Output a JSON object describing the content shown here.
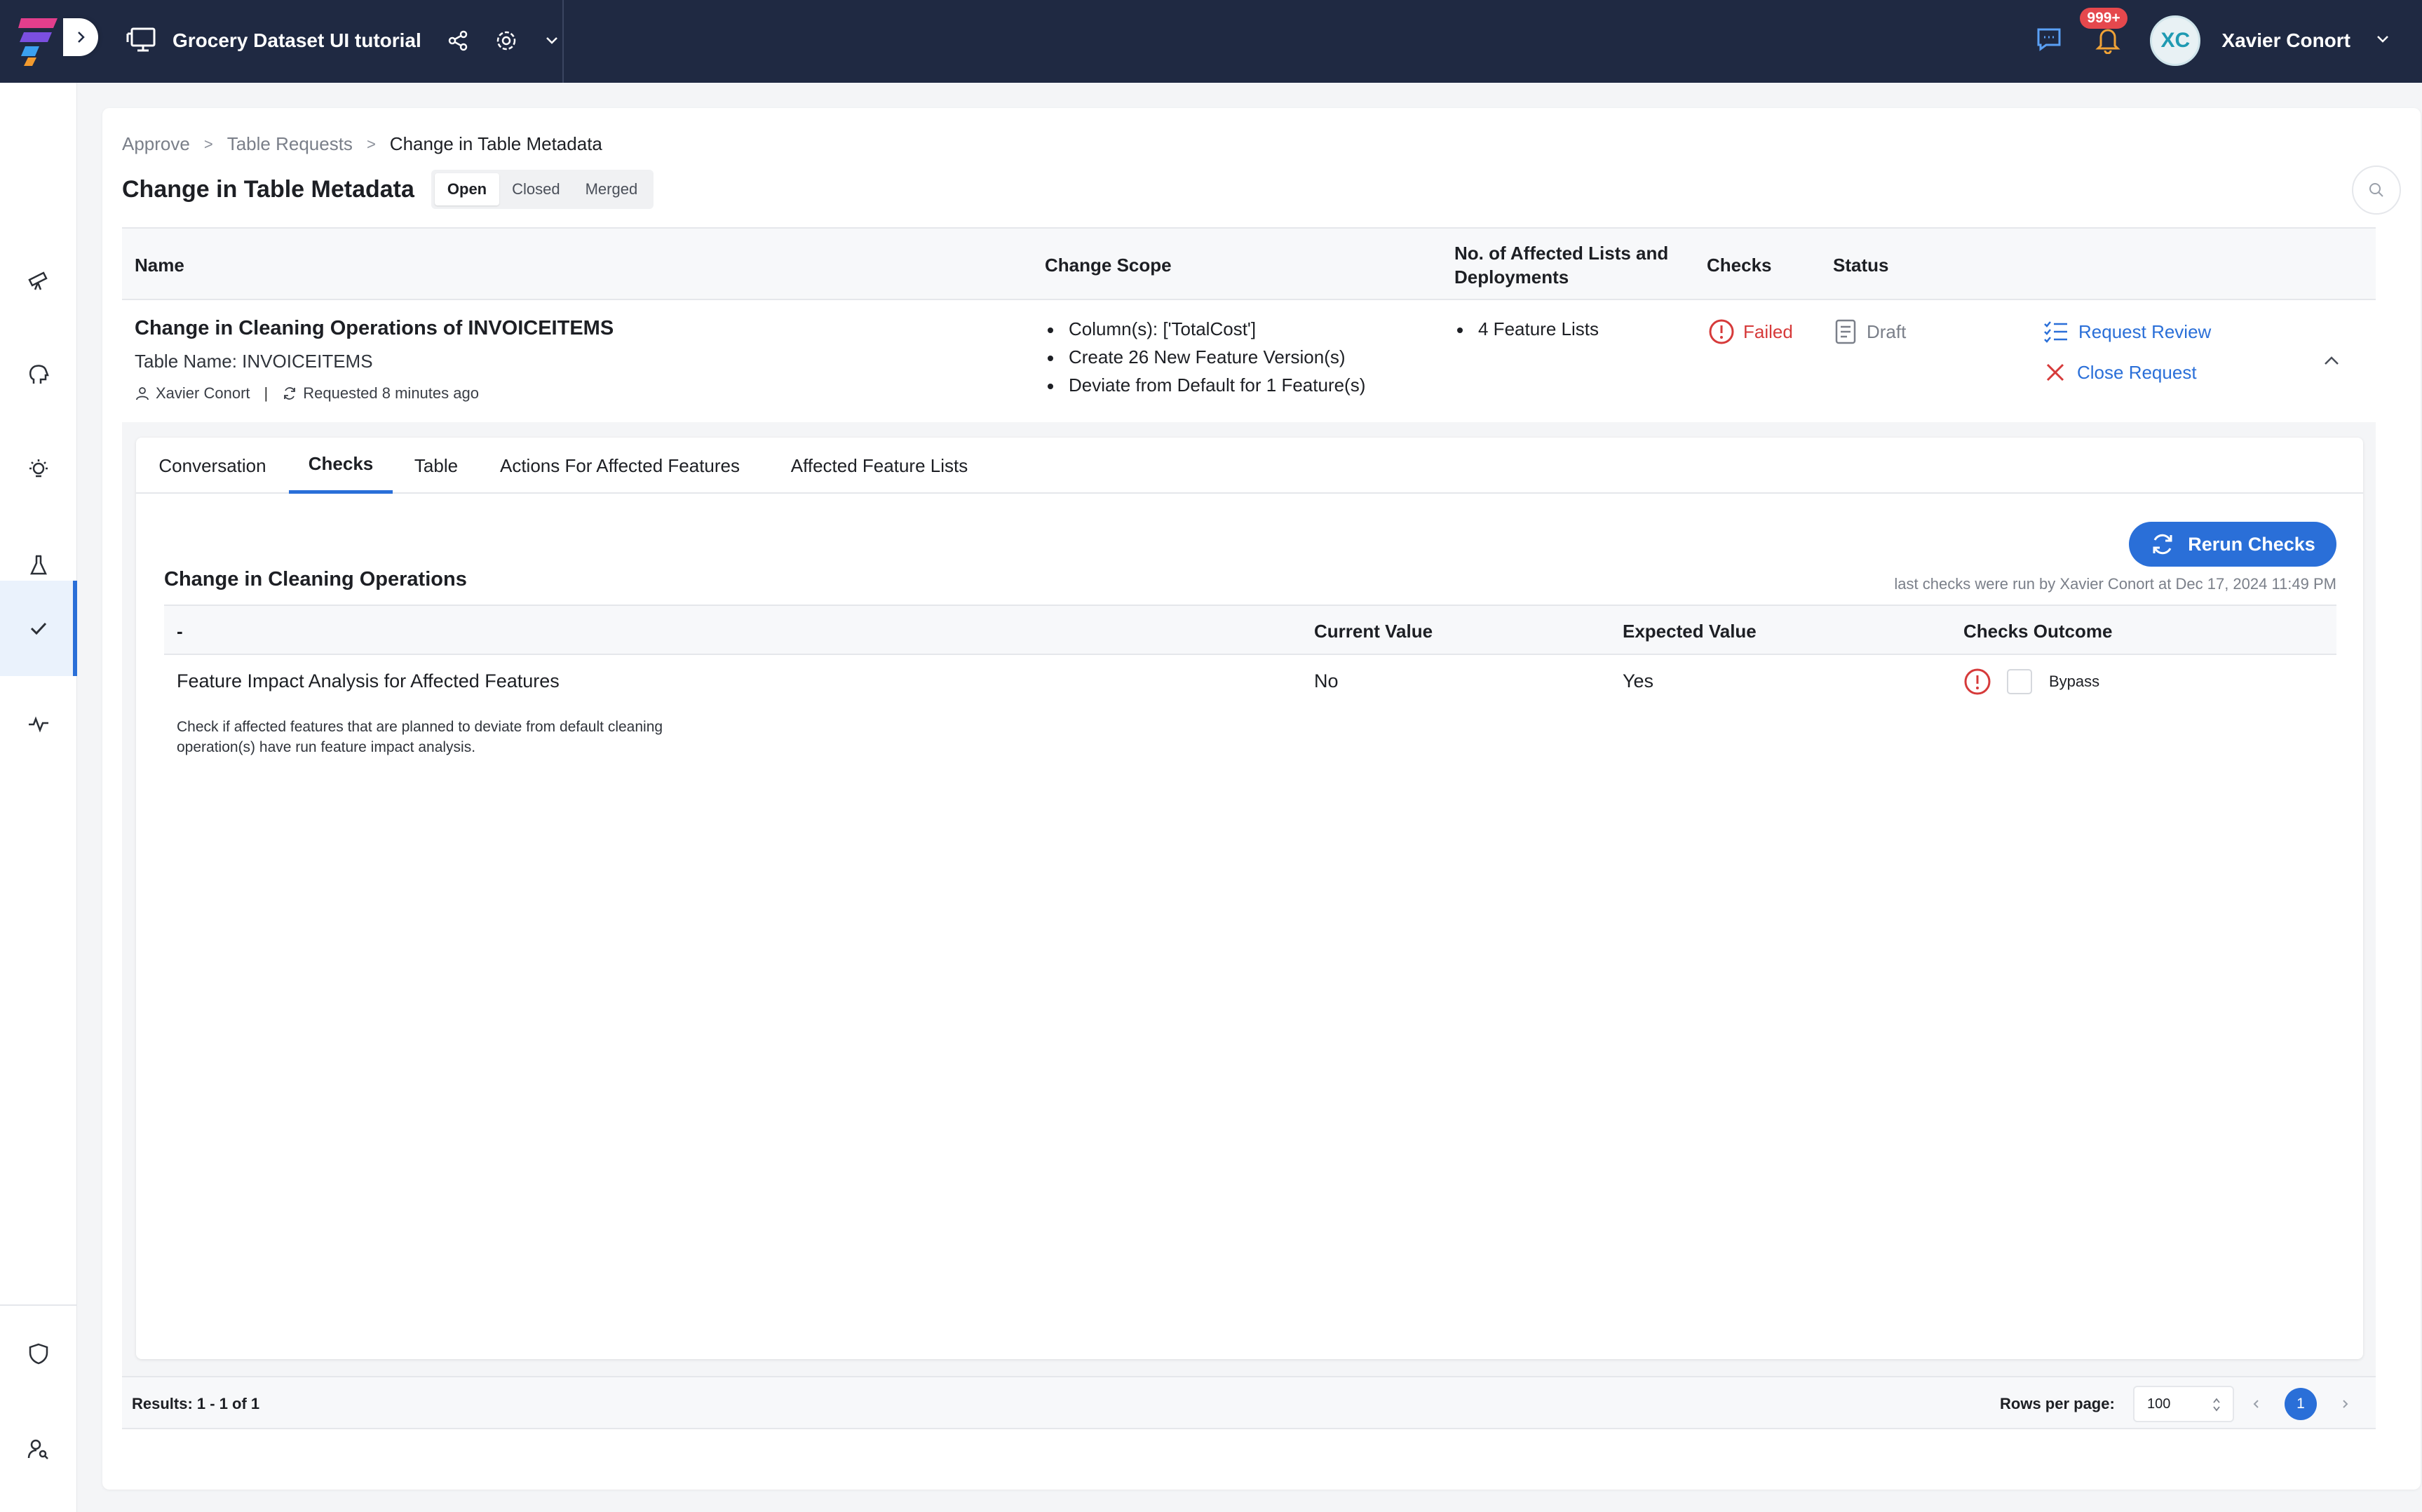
{
  "header": {
    "project_title": "Grocery Dataset UI tutorial",
    "notification_count": "999+",
    "user_initials": "XC",
    "user_name": "Xavier Conort"
  },
  "sidebar": {
    "items": [
      {
        "icon": "telescope-icon",
        "label": ""
      },
      {
        "icon": "brain-icon",
        "label": ""
      },
      {
        "icon": "bulb-icon",
        "label": ""
      },
      {
        "icon": "flask-icon",
        "label": ""
      },
      {
        "icon": "check-icon",
        "label": "",
        "active": true
      },
      {
        "icon": "pulse-icon",
        "label": ""
      },
      {
        "icon": "shield-icon",
        "label": ""
      },
      {
        "icon": "user-search-icon",
        "label": ""
      }
    ]
  },
  "breadcrumb": [
    "Approve",
    "Table Requests",
    "Change in Table Metadata"
  ],
  "breadcrumb_separator": ">",
  "page_title": "Change in Table Metadata",
  "filter_tabs": [
    "Open",
    "Closed",
    "Merged"
  ],
  "active_filter": "Open",
  "requests_table": {
    "headers": {
      "name": "Name",
      "change_scope": "Change Scope",
      "affected": "No. of Affected Lists and Deployments",
      "checks": "Checks",
      "status": "Status"
    },
    "row": {
      "name": "Change in Cleaning Operations of INVOICEITEMS",
      "table_name": "Table Name: INVOICEITEMS",
      "requester": "Xavier Conort",
      "requested": "Requested 8 minutes ago",
      "change_scope": [
        "Column(s): ['TotalCost']",
        "Create 26 New Feature Version(s)",
        "Deviate from Default for 1 Feature(s)"
      ],
      "affected": [
        "4 Feature Lists"
      ],
      "checks": "Failed",
      "status": "Draft",
      "actions": {
        "request_review": "Request Review",
        "close_request": "Close Request"
      }
    }
  },
  "detail_tabs": [
    "Conversation",
    "Checks",
    "Table",
    "Actions For Affected Features",
    "Affected Feature Lists"
  ],
  "active_detail_tab": "Checks",
  "checks_panel": {
    "rerun_label": "Rerun Checks",
    "section_title": "Change in Cleaning Operations",
    "last_run": "last checks were run by Xavier Conort at Dec 17, 2024 11:49 PM",
    "headers": {
      "check": "-",
      "current": "Current Value",
      "expected": "Expected Value",
      "outcome": "Checks Outcome"
    },
    "rows": [
      {
        "name": "Feature Impact Analysis for Affected Features",
        "description": "Check if affected features that are planned to deviate from default cleaning operation(s) have run feature impact analysis.",
        "current": "No",
        "expected": "Yes",
        "bypass_label": "Bypass"
      }
    ]
  },
  "footer": {
    "results": "Results: 1 - 1 of 1",
    "rows_per_page_label": "Rows per page:",
    "rows_per_page_value": "100",
    "current_page": "1"
  },
  "colors": {
    "topbar": "#1f2942",
    "accent": "#2a6fd8",
    "failed": "#d63a3a",
    "badge": "#e5484d"
  }
}
